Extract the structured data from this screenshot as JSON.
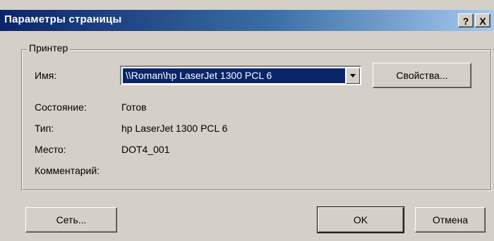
{
  "window": {
    "title": "Параметры страницы",
    "help_label": "?",
    "close_label": "X"
  },
  "printer_group": {
    "legend": "Принтер",
    "name_label": "Имя:",
    "name_value": "\\\\Roman\\hp LaserJet 1300 PCL 6",
    "properties_button": "Свойства...",
    "status_label": "Состояние:",
    "status_value": "Готов",
    "type_label": "Тип:",
    "type_value": "hp LaserJet 1300 PCL 6",
    "location_label": "Место:",
    "location_value": "DOT4_001",
    "comment_label": "Комментарий:",
    "comment_value": ""
  },
  "footer": {
    "network_button": "Сеть...",
    "ok_button": "OK",
    "cancel_button": "Отмена"
  }
}
